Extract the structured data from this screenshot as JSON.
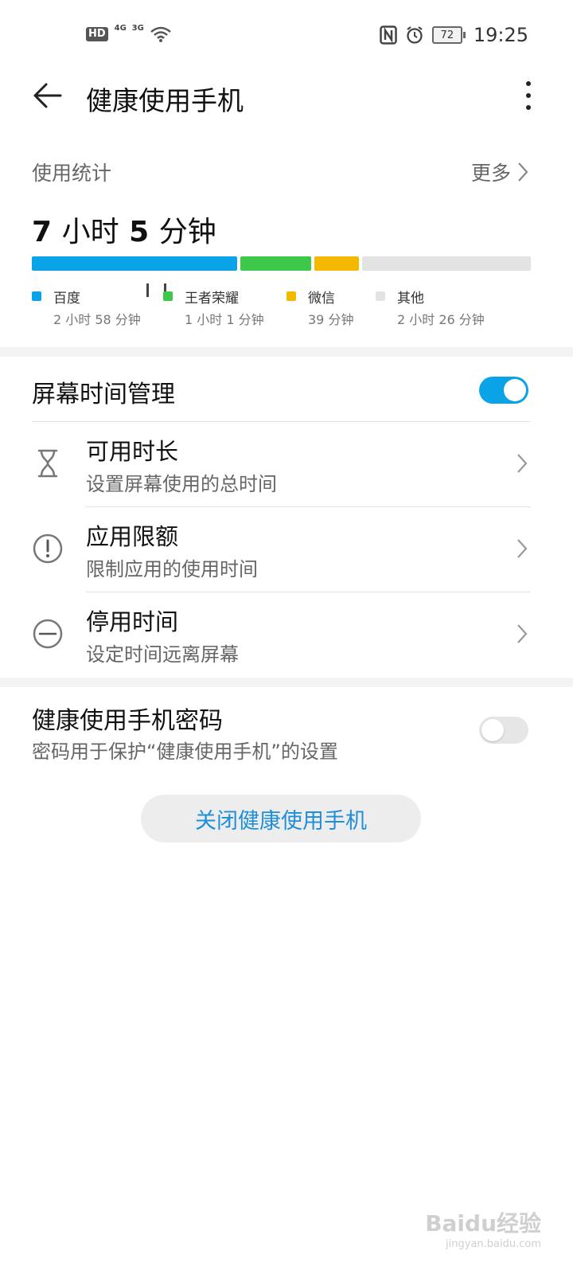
{
  "status_bar": {
    "hd": "HD",
    "sim1": "4G",
    "sim2": "3G",
    "battery": "72",
    "time": "19:25"
  },
  "app_bar": {
    "title": "健康使用手机"
  },
  "usage": {
    "label": "使用统计",
    "more": "更多",
    "total_hours": "7",
    "hours_unit": "小时",
    "total_minutes": "5",
    "minutes_unit": "分钟",
    "apps": [
      {
        "name": "百度",
        "time": "2 小时 58 分钟",
        "color": "#0ba3e8",
        "minutes": 178
      },
      {
        "name": "王者荣耀",
        "time": "1 小时 1 分钟",
        "color": "#3ec84a",
        "minutes": 61
      },
      {
        "name": "微信",
        "time": "39 分钟",
        "color": "#f5b800",
        "minutes": 39
      },
      {
        "name": "其他",
        "time": "2 小时 26 分钟",
        "color": "#e3e3e3",
        "minutes": 146
      }
    ]
  },
  "screen_time": {
    "label": "屏幕时间管理",
    "enabled": true,
    "items": [
      {
        "title": "可用时长",
        "subtitle": "设置屏幕使用的总时间",
        "icon": "hourglass-icon"
      },
      {
        "title": "应用限额",
        "subtitle": "限制应用的使用时间",
        "icon": "exclamation-circle-icon"
      },
      {
        "title": "停用时间",
        "subtitle": "设定时间远离屏幕",
        "icon": "minus-circle-icon"
      }
    ]
  },
  "password": {
    "title": "健康使用手机密码",
    "subtitle": "密码用于保护“健康使用手机”的设置",
    "enabled": false
  },
  "close_button": "关闭健康使用手机",
  "watermark": {
    "line1": "Baidu经验",
    "line2": "jingyan.baidu.com"
  },
  "colors": {
    "accent": "#0ba3e8",
    "toggle_off": "#e6e6e6"
  }
}
